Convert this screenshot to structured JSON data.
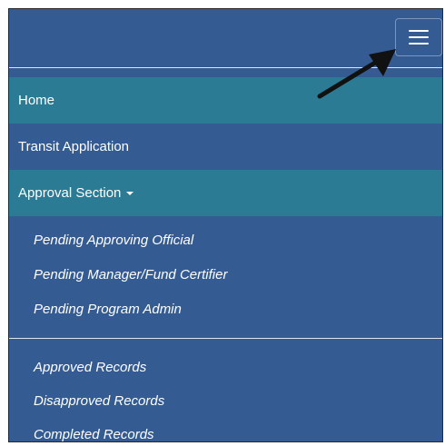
{
  "menu_toggle_icon": "hamburger-menu-icon",
  "annotation_icon": "arrow-pointer-icon",
  "colors": {
    "nav_background": "#355b93",
    "highlight": "#2c7b94",
    "text": "#ffffff"
  },
  "nav": {
    "items": [
      {
        "label": "Home"
      },
      {
        "label": "Transit Application"
      },
      {
        "label": "Approval Section"
      }
    ],
    "dropdown_group_1": [
      {
        "label": "Pending Approving Official"
      },
      {
        "label": "Pending Manager/Fund Certifier"
      },
      {
        "label": "Pending Program Admin"
      }
    ],
    "dropdown_group_2": [
      {
        "label": "Approved Records"
      },
      {
        "label": "Disapproved Records"
      },
      {
        "label": "Completed Records"
      }
    ]
  }
}
